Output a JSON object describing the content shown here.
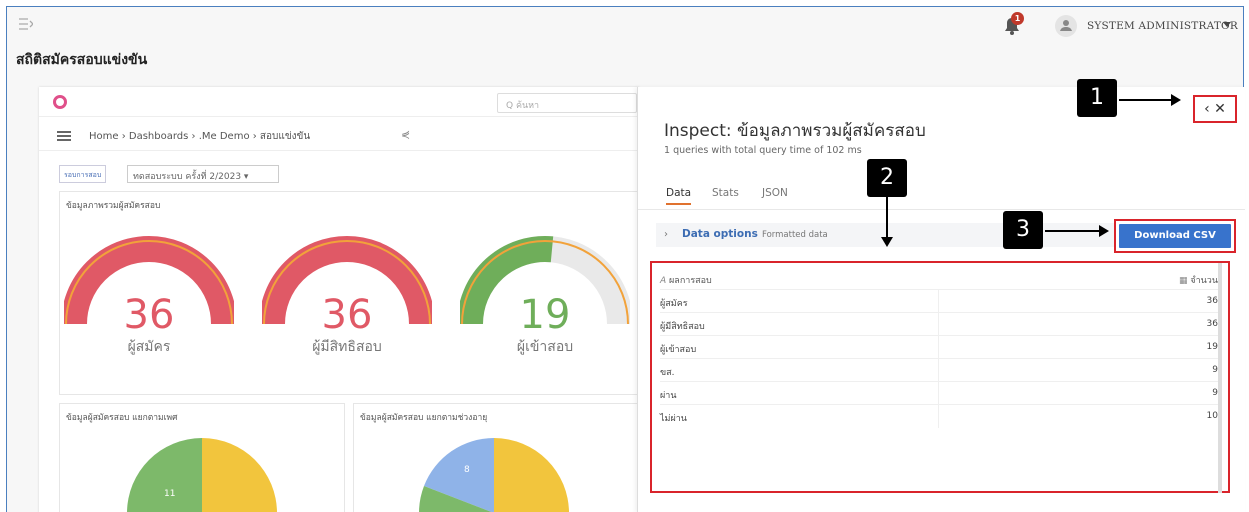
{
  "app": {
    "menu_icon": "menu-collapse-icon",
    "notifications_badge": "1",
    "user_name": "SYSTEM ADMINISTRATOR",
    "page_title": "สถิติสมัครสอบแข่งขัน"
  },
  "dashboard": {
    "search_placeholder": "Q ค้นหา",
    "breadcrumb": "Home › Dashboards › .Me Demo › สอบแข่งขัน",
    "filter_label": "รอบการสอบ",
    "filter_value": "ทดสอบระบบ ครั้งที่ 2/2023 ▾",
    "overview_title": "ข้อมูลภาพรวมผู้สมัครสอบ",
    "gauges": [
      {
        "value": "36",
        "label": "ผู้สมัคร",
        "fill": 1.0,
        "color": "#e05966"
      },
      {
        "value": "36",
        "label": "ผู้มีสิทธิสอบ",
        "fill": 1.0,
        "color": "#e05966"
      },
      {
        "value": "19",
        "label": "ผู้เข้าสอบ",
        "fill": 0.53,
        "color": "#6fae5a"
      }
    ],
    "gender_title": "ข้อมูลผู้สมัครสอบ แยกตามเพศ",
    "age_title": "ข้อมูลผู้สมัครสอบ แยกตามช่วงอายุ",
    "gender_pie_label": "11",
    "age_pie_label": "8"
  },
  "inspect": {
    "title": "Inspect: ข้อมูลภาพรวมผู้สมัครสอบ",
    "subtitle": "1 queries with total query time of 102 ms",
    "nav_buttons": "‹  ✕",
    "tabs": [
      "Data",
      "Stats",
      "JSON"
    ],
    "data_options": "Data options",
    "formatted_data": "Formatted data",
    "download_button": "Download CSV",
    "table": {
      "col1": "ผลการสอบ",
      "col2": "จำนวน",
      "rows": [
        {
          "name": "ผู้สมัคร",
          "count": "36"
        },
        {
          "name": "ผู้มีสิทธิสอบ",
          "count": "36"
        },
        {
          "name": "ผู้เข้าสอบ",
          "count": "19"
        },
        {
          "name": "ขส.",
          "count": "9"
        },
        {
          "name": "ผ่าน",
          "count": "9"
        },
        {
          "name": "ไม่ผ่าน",
          "count": "10"
        }
      ]
    }
  },
  "callouts": [
    "1",
    "2",
    "3"
  ],
  "colors": {
    "accent_blue": "#3873cc",
    "annotation_red": "#d9242b",
    "gauge_red": "#e05966",
    "gauge_green": "#6fae5a",
    "pie_green": "#7db96a",
    "pie_yellow": "#f2c53d",
    "pie_blue": "#8fb3e8"
  }
}
